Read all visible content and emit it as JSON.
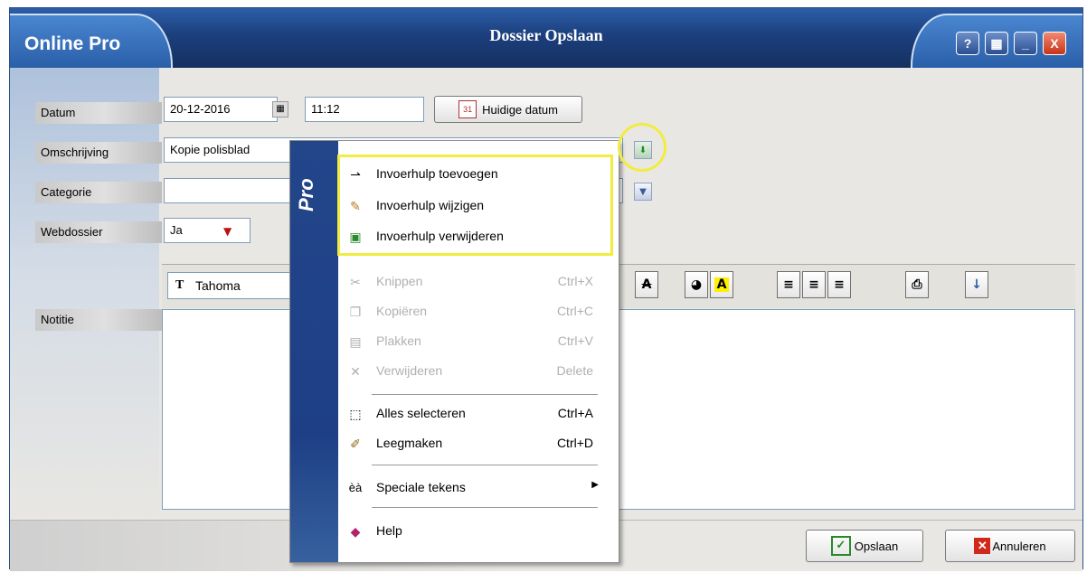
{
  "window": {
    "app_name": "Online Pro",
    "title": "Dossier Opslaan",
    "help_glyph": "?",
    "close_glyph": "X",
    "min_glyph": "_"
  },
  "form": {
    "datum_label": "Datum",
    "date_value": "20-12-2016",
    "time_value": "11:12",
    "huidige_label": "Huidige datum",
    "omschrijving_label": "Omschrijving",
    "omschrijving_value": "Kopie polisblad",
    "categorie_label": "Categorie",
    "categorie_value": "",
    "webdossier_label": "Webdossier",
    "webdossier_value": "Ja",
    "notitie_label": "Notitie",
    "font_name": "Tahoma"
  },
  "toolbar": {
    "font_icon": "font-icon"
  },
  "context_menu": {
    "brand": "Pro",
    "items": [
      {
        "label": "Invoerhulp toevoegen",
        "shortcut": "",
        "icon": "arrow-link-icon",
        "enabled": true
      },
      {
        "label": "Invoerhulp wijzigen",
        "shortcut": "",
        "icon": "pencil-icon",
        "enabled": true
      },
      {
        "label": "Invoerhulp verwijderen",
        "shortcut": "",
        "icon": "document-delete-icon",
        "enabled": true
      },
      {
        "label": "Knippen",
        "shortcut": "Ctrl+X",
        "icon": "scissors-icon",
        "enabled": false
      },
      {
        "label": "Kopiëren",
        "shortcut": "Ctrl+C",
        "icon": "copy-icon",
        "enabled": false
      },
      {
        "label": "Plakken",
        "shortcut": "Ctrl+V",
        "icon": "paste-icon",
        "enabled": false
      },
      {
        "label": "Verwijderen",
        "shortcut": "Delete",
        "icon": "x-icon",
        "enabled": false
      },
      {
        "label": "Alles selecteren",
        "shortcut": "Ctrl+A",
        "icon": "select-all-icon",
        "enabled": true
      },
      {
        "label": "Leegmaken",
        "shortcut": "Ctrl+D",
        "icon": "broom-icon",
        "enabled": true
      },
      {
        "label": "Speciale tekens",
        "shortcut": "",
        "icon": "special-chars-icon",
        "icon_text": "èà",
        "enabled": true
      },
      {
        "label": "Help",
        "shortcut": "",
        "icon": "book-icon",
        "enabled": true
      }
    ]
  },
  "actions": {
    "save_label": "Opslaan",
    "cancel_label": "Annuleren"
  },
  "colors": {
    "title_blue": "#1c3f7d",
    "highlight": "#f1ec40",
    "menu_strip": "#1e3f86"
  }
}
